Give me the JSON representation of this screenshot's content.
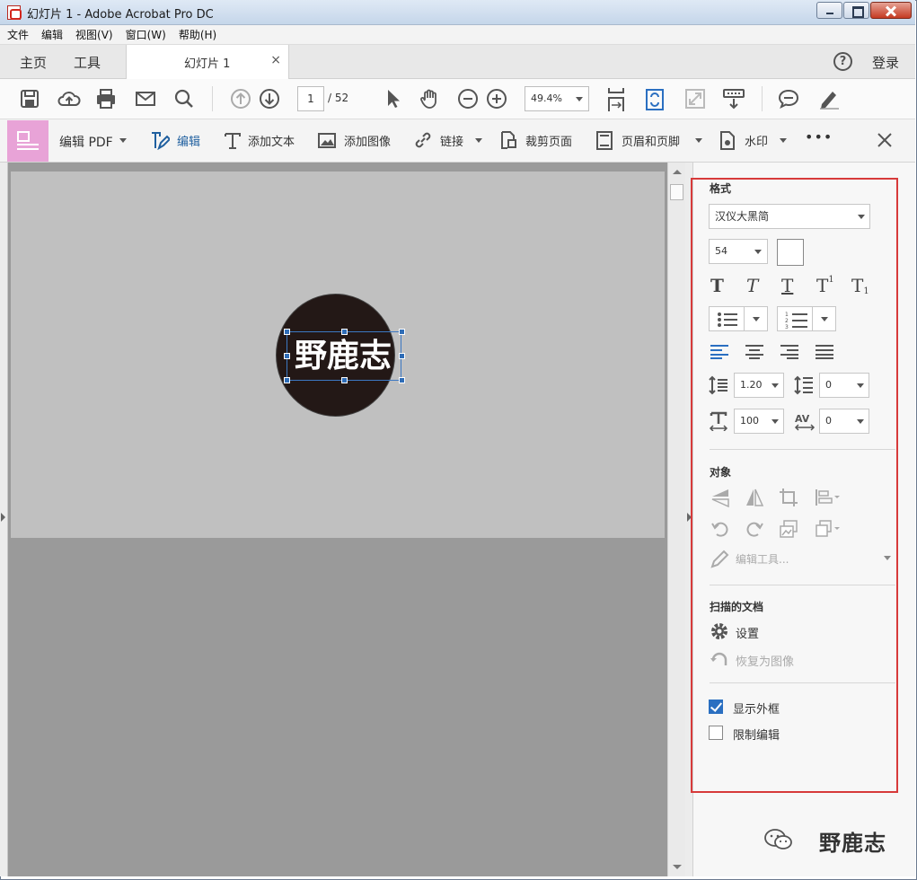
{
  "window": {
    "title": "幻灯片 1 - Adobe Acrobat Pro DC"
  },
  "menu": {
    "items": [
      "文件",
      "编辑",
      "视图(V)",
      "窗口(W)",
      "帮助(H)"
    ]
  },
  "tabs": {
    "home": "主页",
    "tools": "工具",
    "document": "幻灯片 1",
    "close": "×",
    "help": "?",
    "login": "登录"
  },
  "toolbar": {
    "page_current": "1",
    "page_total": "/ 52",
    "zoom": "49.4%"
  },
  "edit_toolbar": {
    "mode": "编辑 PDF",
    "items": [
      "编辑",
      "添加文本",
      "添加图像",
      "链接",
      "裁剪页面",
      "页眉和页脚",
      "水印"
    ],
    "more": "•••"
  },
  "slide": {
    "text": "野鹿志",
    "circle_color": "#231816"
  },
  "format_panel": {
    "format_title": "格式",
    "font": "汉仪大黑简",
    "size": "54",
    "line_spacing": "1.20",
    "para_spacing": "0",
    "scale": "100",
    "char_spacing": "0",
    "object_title": "对象",
    "edit_tools": "编辑工具...",
    "scanned_title": "扫描的文档",
    "settings": "设置",
    "revert": "恢复为图像",
    "show_frame": "显示外框",
    "restrict": "限制编辑",
    "show_frame_checked": true,
    "restrict_checked": false
  },
  "watermark": {
    "text": "野鹿志"
  },
  "colors": {
    "accent": "#2a6fc1",
    "edit_icon": "#e8a3d7",
    "highlight_frame": "#d73a3a"
  }
}
